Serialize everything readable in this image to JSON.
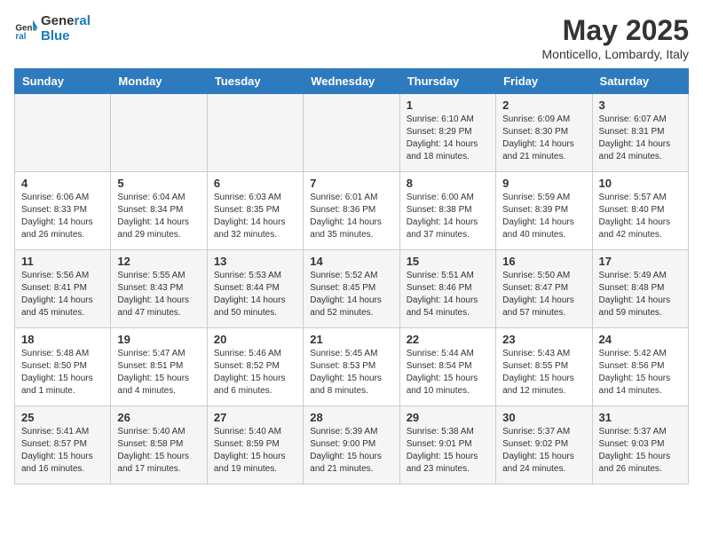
{
  "header": {
    "logo_line1": "General",
    "logo_line2": "Blue",
    "month": "May 2025",
    "location": "Monticello, Lombardy, Italy"
  },
  "days_of_week": [
    "Sunday",
    "Monday",
    "Tuesday",
    "Wednesday",
    "Thursday",
    "Friday",
    "Saturday"
  ],
  "weeks": [
    [
      {
        "num": "",
        "info": ""
      },
      {
        "num": "",
        "info": ""
      },
      {
        "num": "",
        "info": ""
      },
      {
        "num": "",
        "info": ""
      },
      {
        "num": "1",
        "info": "Sunrise: 6:10 AM\nSunset: 8:29 PM\nDaylight: 14 hours\nand 18 minutes."
      },
      {
        "num": "2",
        "info": "Sunrise: 6:09 AM\nSunset: 8:30 PM\nDaylight: 14 hours\nand 21 minutes."
      },
      {
        "num": "3",
        "info": "Sunrise: 6:07 AM\nSunset: 8:31 PM\nDaylight: 14 hours\nand 24 minutes."
      }
    ],
    [
      {
        "num": "4",
        "info": "Sunrise: 6:06 AM\nSunset: 8:33 PM\nDaylight: 14 hours\nand 26 minutes."
      },
      {
        "num": "5",
        "info": "Sunrise: 6:04 AM\nSunset: 8:34 PM\nDaylight: 14 hours\nand 29 minutes."
      },
      {
        "num": "6",
        "info": "Sunrise: 6:03 AM\nSunset: 8:35 PM\nDaylight: 14 hours\nand 32 minutes."
      },
      {
        "num": "7",
        "info": "Sunrise: 6:01 AM\nSunset: 8:36 PM\nDaylight: 14 hours\nand 35 minutes."
      },
      {
        "num": "8",
        "info": "Sunrise: 6:00 AM\nSunset: 8:38 PM\nDaylight: 14 hours\nand 37 minutes."
      },
      {
        "num": "9",
        "info": "Sunrise: 5:59 AM\nSunset: 8:39 PM\nDaylight: 14 hours\nand 40 minutes."
      },
      {
        "num": "10",
        "info": "Sunrise: 5:57 AM\nSunset: 8:40 PM\nDaylight: 14 hours\nand 42 minutes."
      }
    ],
    [
      {
        "num": "11",
        "info": "Sunrise: 5:56 AM\nSunset: 8:41 PM\nDaylight: 14 hours\nand 45 minutes."
      },
      {
        "num": "12",
        "info": "Sunrise: 5:55 AM\nSunset: 8:43 PM\nDaylight: 14 hours\nand 47 minutes."
      },
      {
        "num": "13",
        "info": "Sunrise: 5:53 AM\nSunset: 8:44 PM\nDaylight: 14 hours\nand 50 minutes."
      },
      {
        "num": "14",
        "info": "Sunrise: 5:52 AM\nSunset: 8:45 PM\nDaylight: 14 hours\nand 52 minutes."
      },
      {
        "num": "15",
        "info": "Sunrise: 5:51 AM\nSunset: 8:46 PM\nDaylight: 14 hours\nand 54 minutes."
      },
      {
        "num": "16",
        "info": "Sunrise: 5:50 AM\nSunset: 8:47 PM\nDaylight: 14 hours\nand 57 minutes."
      },
      {
        "num": "17",
        "info": "Sunrise: 5:49 AM\nSunset: 8:48 PM\nDaylight: 14 hours\nand 59 minutes."
      }
    ],
    [
      {
        "num": "18",
        "info": "Sunrise: 5:48 AM\nSunset: 8:50 PM\nDaylight: 15 hours\nand 1 minute."
      },
      {
        "num": "19",
        "info": "Sunrise: 5:47 AM\nSunset: 8:51 PM\nDaylight: 15 hours\nand 4 minutes."
      },
      {
        "num": "20",
        "info": "Sunrise: 5:46 AM\nSunset: 8:52 PM\nDaylight: 15 hours\nand 6 minutes."
      },
      {
        "num": "21",
        "info": "Sunrise: 5:45 AM\nSunset: 8:53 PM\nDaylight: 15 hours\nand 8 minutes."
      },
      {
        "num": "22",
        "info": "Sunrise: 5:44 AM\nSunset: 8:54 PM\nDaylight: 15 hours\nand 10 minutes."
      },
      {
        "num": "23",
        "info": "Sunrise: 5:43 AM\nSunset: 8:55 PM\nDaylight: 15 hours\nand 12 minutes."
      },
      {
        "num": "24",
        "info": "Sunrise: 5:42 AM\nSunset: 8:56 PM\nDaylight: 15 hours\nand 14 minutes."
      }
    ],
    [
      {
        "num": "25",
        "info": "Sunrise: 5:41 AM\nSunset: 8:57 PM\nDaylight: 15 hours\nand 16 minutes."
      },
      {
        "num": "26",
        "info": "Sunrise: 5:40 AM\nSunset: 8:58 PM\nDaylight: 15 hours\nand 17 minutes."
      },
      {
        "num": "27",
        "info": "Sunrise: 5:40 AM\nSunset: 8:59 PM\nDaylight: 15 hours\nand 19 minutes."
      },
      {
        "num": "28",
        "info": "Sunrise: 5:39 AM\nSunset: 9:00 PM\nDaylight: 15 hours\nand 21 minutes."
      },
      {
        "num": "29",
        "info": "Sunrise: 5:38 AM\nSunset: 9:01 PM\nDaylight: 15 hours\nand 23 minutes."
      },
      {
        "num": "30",
        "info": "Sunrise: 5:37 AM\nSunset: 9:02 PM\nDaylight: 15 hours\nand 24 minutes."
      },
      {
        "num": "31",
        "info": "Sunrise: 5:37 AM\nSunset: 9:03 PM\nDaylight: 15 hours\nand 26 minutes."
      }
    ]
  ]
}
